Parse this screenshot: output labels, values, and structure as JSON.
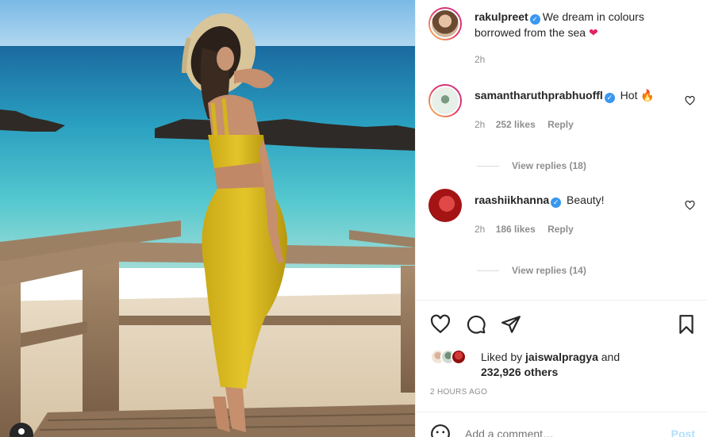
{
  "caption": {
    "username": "rakulpreet",
    "text": "We dream in colours borrowed from the sea",
    "time": "2h"
  },
  "comments": [
    {
      "username": "samantharuthprabhuoffl",
      "text": "Hot",
      "time": "2h",
      "likes": "252 likes",
      "reply_label": "Reply",
      "view_replies": "View replies (18)"
    },
    {
      "username": "raashiikhanna",
      "text": "Beauty!",
      "time": "2h",
      "likes": "186 likes",
      "reply_label": "Reply",
      "view_replies": "View replies (14)"
    }
  ],
  "likes_summary": {
    "prefix": "Liked by",
    "user": "jaiswalpragya",
    "joiner": "and",
    "others": "232,926 others"
  },
  "post_time": "2 HOURS AGO",
  "comment_input": {
    "placeholder": "Add a comment…",
    "post_label": "Post"
  },
  "icons": {
    "like": "heart-icon",
    "comment": "comment-icon",
    "share": "paper-plane-icon",
    "save": "bookmark-icon",
    "emoji": "smiley-icon",
    "verified": "verified-badge-icon",
    "caption_emoji": "red-heart-emoji",
    "comment_emoji": "fire-emoji"
  },
  "colors": {
    "verified_blue": "#3897f0",
    "muted_text": "#8e8e8e",
    "post_disabled": "#b2dffc",
    "divider": "#efefef"
  }
}
